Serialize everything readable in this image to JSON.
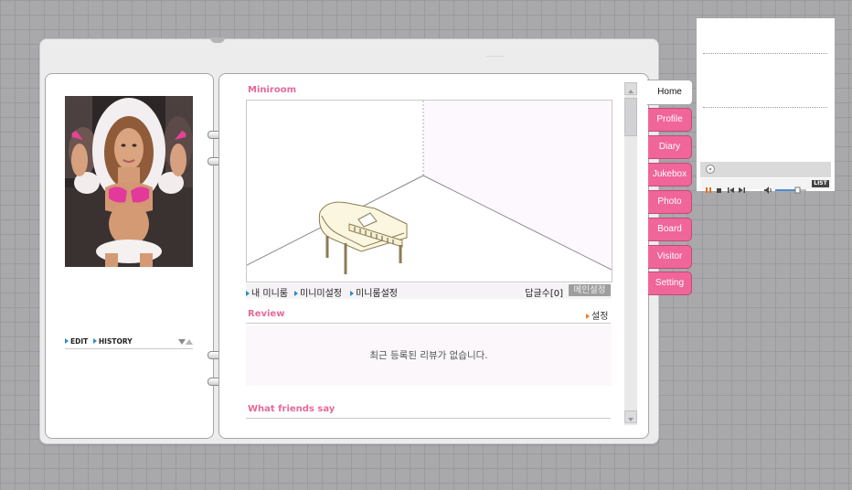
{
  "left_panel": {
    "edit_label": "EDIT",
    "history_label": "HISTORY"
  },
  "miniroom": {
    "title": "Miniroom",
    "links": [
      "내 미니룸",
      "미니미설정",
      "미니룸설정"
    ],
    "reply_count": "답글수[0]",
    "main_setting_button": "메인설정"
  },
  "review": {
    "title": "Review",
    "setting_link": "설정",
    "empty_message": "최근 등록된 리뷰가 없습니다."
  },
  "friends": {
    "title": "What friends say"
  },
  "tabs": [
    {
      "label": "Home",
      "active": true
    },
    {
      "label": "Profile",
      "active": false
    },
    {
      "label": "Diary",
      "active": false
    },
    {
      "label": "Jukebox",
      "active": false
    },
    {
      "label": "Photo",
      "active": false
    },
    {
      "label": "Board",
      "active": false
    },
    {
      "label": "Visitor",
      "active": false
    },
    {
      "label": "Setting",
      "active": false
    }
  ],
  "player": {
    "list_button": "LIST",
    "volume_level": 0.7
  },
  "colors": {
    "accent_pink": "#e6699a",
    "tab_pink": "#f0659a",
    "bullet_blue": "#2d8cc0",
    "bullet_orange": "#f07a22"
  },
  "icons": [
    "play-pause-icon",
    "stop-icon",
    "prev-icon",
    "next-icon",
    "volume-icon",
    "cd-icon",
    "piano-icon"
  ]
}
